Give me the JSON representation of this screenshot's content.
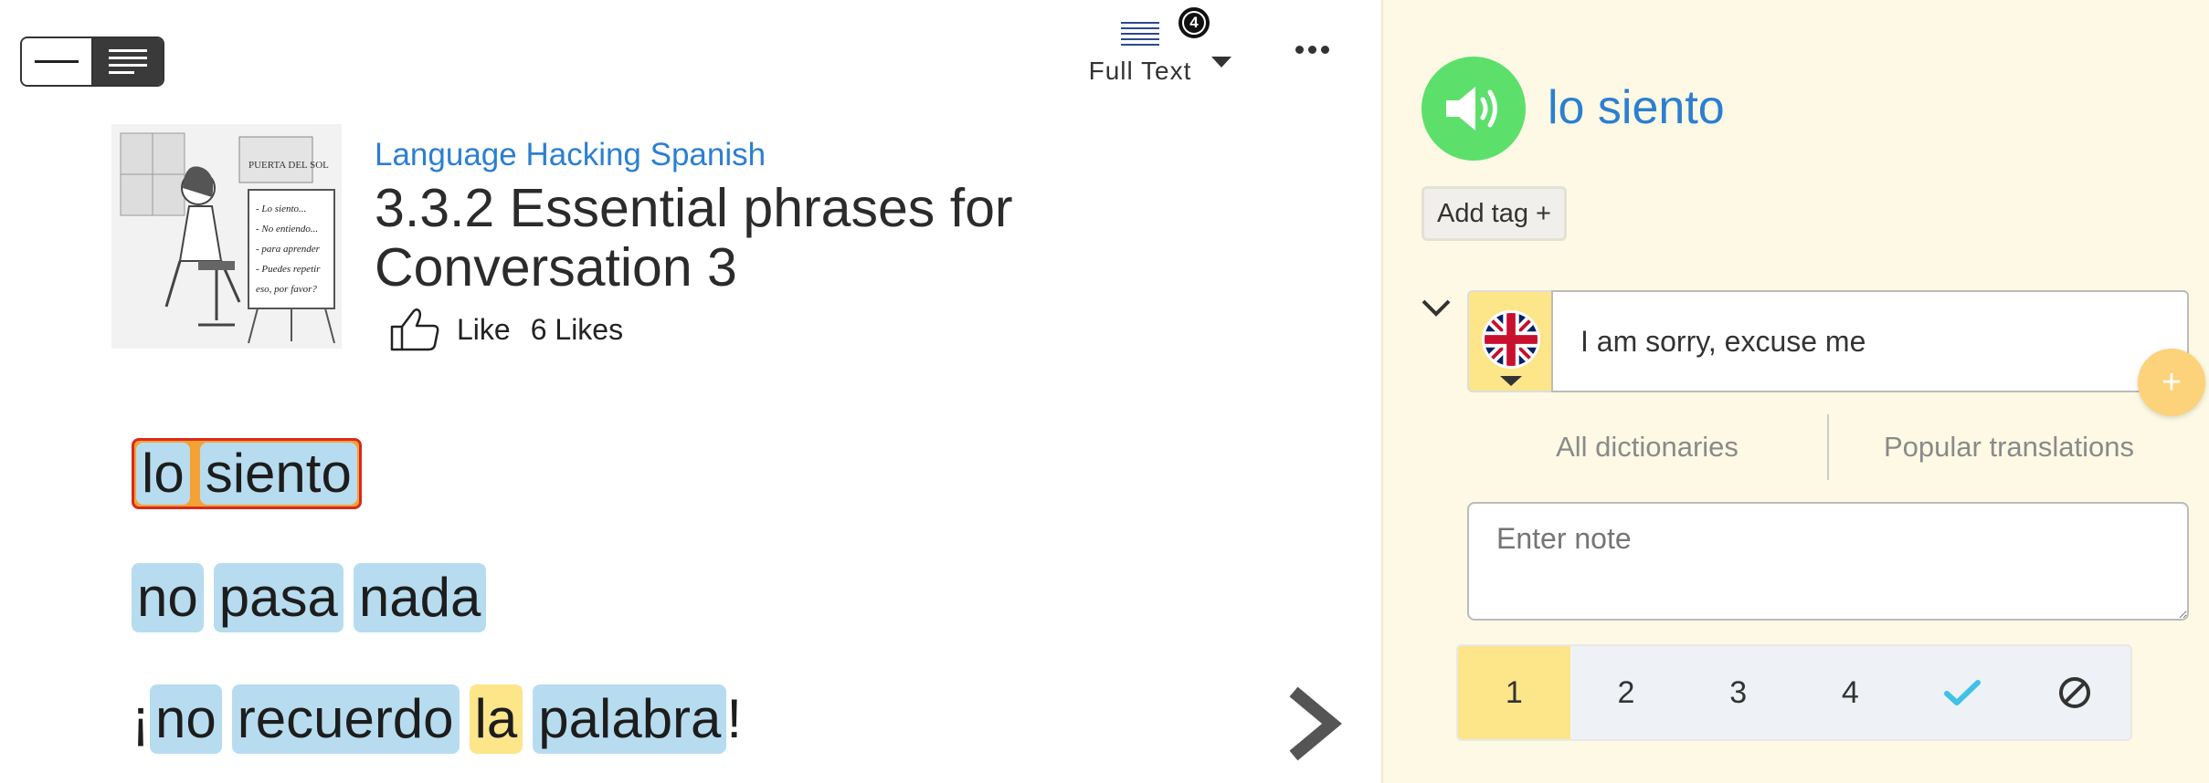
{
  "toolbar": {
    "full_text_label": "Full Text",
    "badge_count": "4"
  },
  "lesson": {
    "course": "Language Hacking Spanish",
    "title": "3.3.2 Essential phrases for Conversation 3",
    "like_label": "Like",
    "likes_text": "6 Likes",
    "thumbnail_text": [
      "PUERTA DEL SOL",
      "- Lo siento...",
      "- No entiendo...",
      "- para aprender",
      "- Puedes repetir",
      "eso, por favor?"
    ]
  },
  "reading": {
    "phrase1": [
      "lo",
      "siento"
    ],
    "phrase2": [
      "no",
      "pasa",
      "nada"
    ],
    "phrase3": {
      "open_punct": "¡",
      "words": [
        "no",
        "recuerdo",
        "la",
        "palabra"
      ],
      "close_punct": "!"
    }
  },
  "panel": {
    "term": "lo siento",
    "add_tag_label": "Add tag +",
    "translation": "I am sorry, excuse me",
    "plus_label": "+",
    "dict_tabs": [
      "All dictionaries",
      "Popular translations"
    ],
    "note_placeholder": "Enter note",
    "status": {
      "levels": [
        "1",
        "2",
        "3",
        "4"
      ],
      "selected": "1",
      "known_icon": "checkmark-icon",
      "ignore_icon": "ignore-icon"
    }
  },
  "colors": {
    "accent_blue": "#2c7fd1",
    "lingq_blue": "#b7dcef",
    "known_yellow": "#fde58a",
    "speaker_green": "#5ce06b",
    "panel_bg": "#fdf9e4",
    "selected_border": "#d92a1c"
  }
}
